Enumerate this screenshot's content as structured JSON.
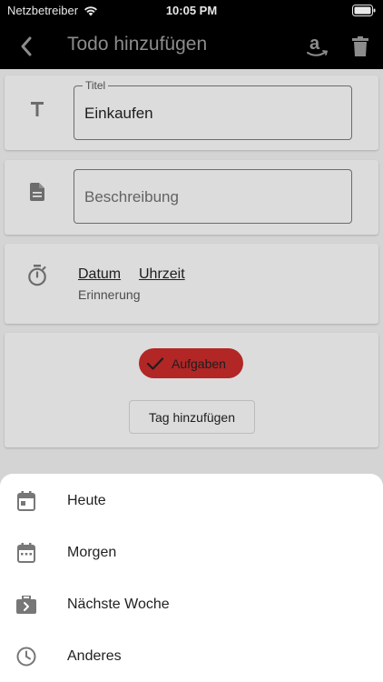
{
  "status_bar": {
    "carrier": "Netzbetreiber",
    "time": "10:05 PM"
  },
  "app_bar": {
    "title": "Todo hinzufügen",
    "icons": [
      "back-arrow-icon",
      "amazon-icon",
      "trash-icon"
    ]
  },
  "title_field": {
    "label": "Titel",
    "value": "Einkaufen"
  },
  "description_field": {
    "placeholder": "Beschreibung"
  },
  "reminder": {
    "date_link": "Datum",
    "time_link": "Uhrzeit",
    "caption": "Erinnerung"
  },
  "tags": {
    "chip_label": "Aufgaben",
    "chip_color": "#c42a2a",
    "add_button": "Tag hinzufügen"
  },
  "sheet": {
    "items": [
      {
        "label": "Heute",
        "icon": "calendar-today-icon"
      },
      {
        "label": "Morgen",
        "icon": "calendar-icon"
      },
      {
        "label": "Nächste Woche",
        "icon": "next-week-icon"
      },
      {
        "label": "Anderes",
        "icon": "clock-icon"
      }
    ]
  }
}
